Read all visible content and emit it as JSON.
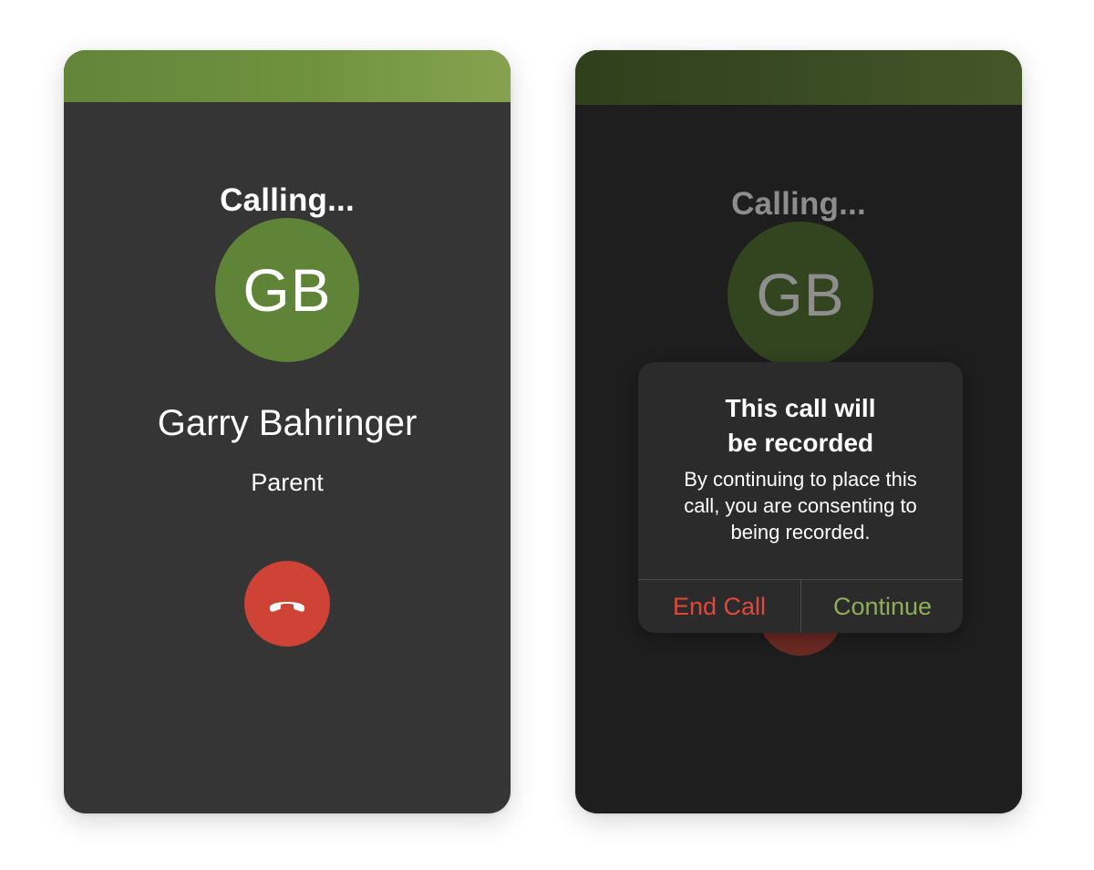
{
  "left_screen": {
    "status": "Calling...",
    "avatar_initials": "GB",
    "caller_name": "Garry Bahringer",
    "caller_role": "Parent",
    "hangup_icon": "phone-hangup-icon"
  },
  "right_screen": {
    "status": "Calling...",
    "avatar_initials": "GB",
    "dialog": {
      "title_line1": "This call will",
      "title_line2": "be recorded",
      "message_line1": "By continuing to place this",
      "message_line2": "call, you are consenting to",
      "message_line3": "being recorded.",
      "end_call_label": "End Call",
      "continue_label": "Continue"
    }
  },
  "colors": {
    "accent_green": "#5f8337",
    "hangup_red": "#cf4236",
    "end_call_red": "#e0483c",
    "continue_green": "#8fae5a"
  }
}
